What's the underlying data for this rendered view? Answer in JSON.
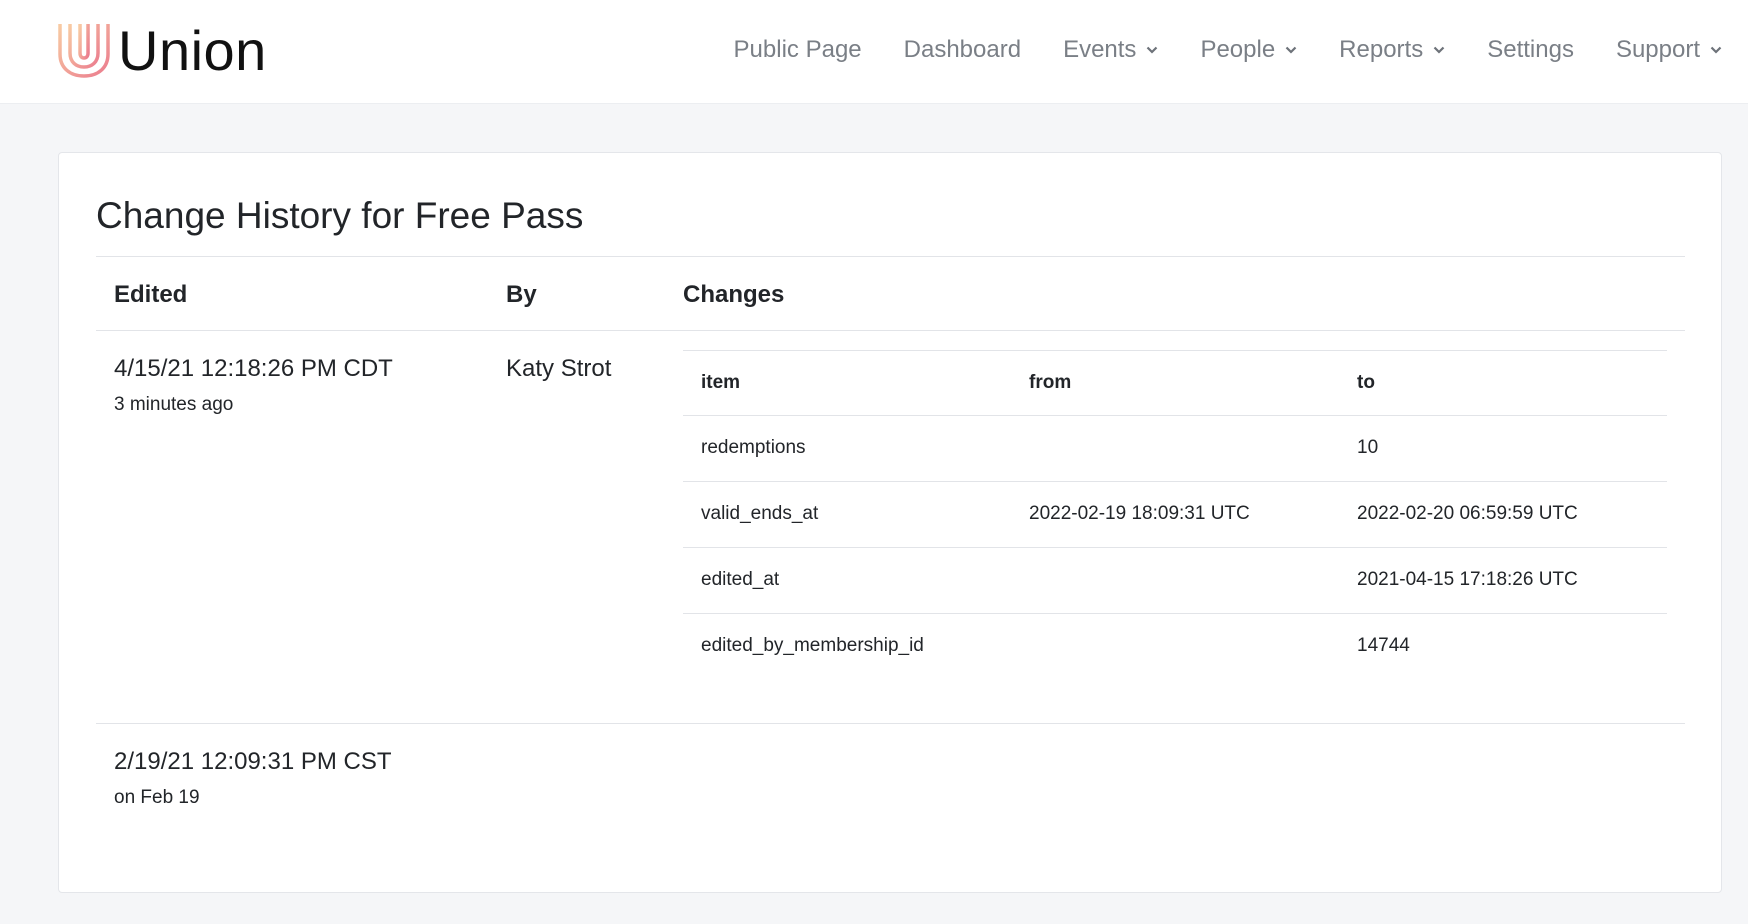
{
  "brand": {
    "name": "Union"
  },
  "nav": {
    "items": [
      {
        "label": "Public Page"
      },
      {
        "label": "Dashboard"
      },
      {
        "label": "Events"
      },
      {
        "label": "People"
      },
      {
        "label": "Reports"
      },
      {
        "label": "Settings"
      },
      {
        "label": "Support"
      }
    ]
  },
  "page": {
    "title": "Change History for Free Pass"
  },
  "table": {
    "headers": {
      "edited": "Edited",
      "by": "By",
      "changes": "Changes"
    },
    "entries": [
      {
        "date": "4/15/21 12:18:26 PM CDT",
        "relative": "3 minutes ago",
        "by": "Katy Strot",
        "changes": {
          "headers": {
            "item": "item",
            "from": "from",
            "to": "to"
          },
          "rows": [
            {
              "item": "redemptions",
              "from": "",
              "to": "10"
            },
            {
              "item": "valid_ends_at",
              "from": "2022-02-19 18:09:31 UTC",
              "to": "2022-02-20 06:59:59 UTC"
            },
            {
              "item": "edited_at",
              "from": "",
              "to": "2021-04-15 17:18:26 UTC"
            },
            {
              "item": "edited_by_membership_id",
              "from": "",
              "to": "14744"
            }
          ]
        }
      },
      {
        "date": "2/19/21 12:09:31 PM CST",
        "relative": "on Feb 19",
        "by": ""
      }
    ]
  },
  "colors": {
    "background": "#f5f6f8",
    "text": "#222529",
    "nav_text": "#7a7f86",
    "divider": "#e2e4e8",
    "logo_gradient_start": "#f8c9a1",
    "logo_gradient_end": "#ec7f8f"
  }
}
